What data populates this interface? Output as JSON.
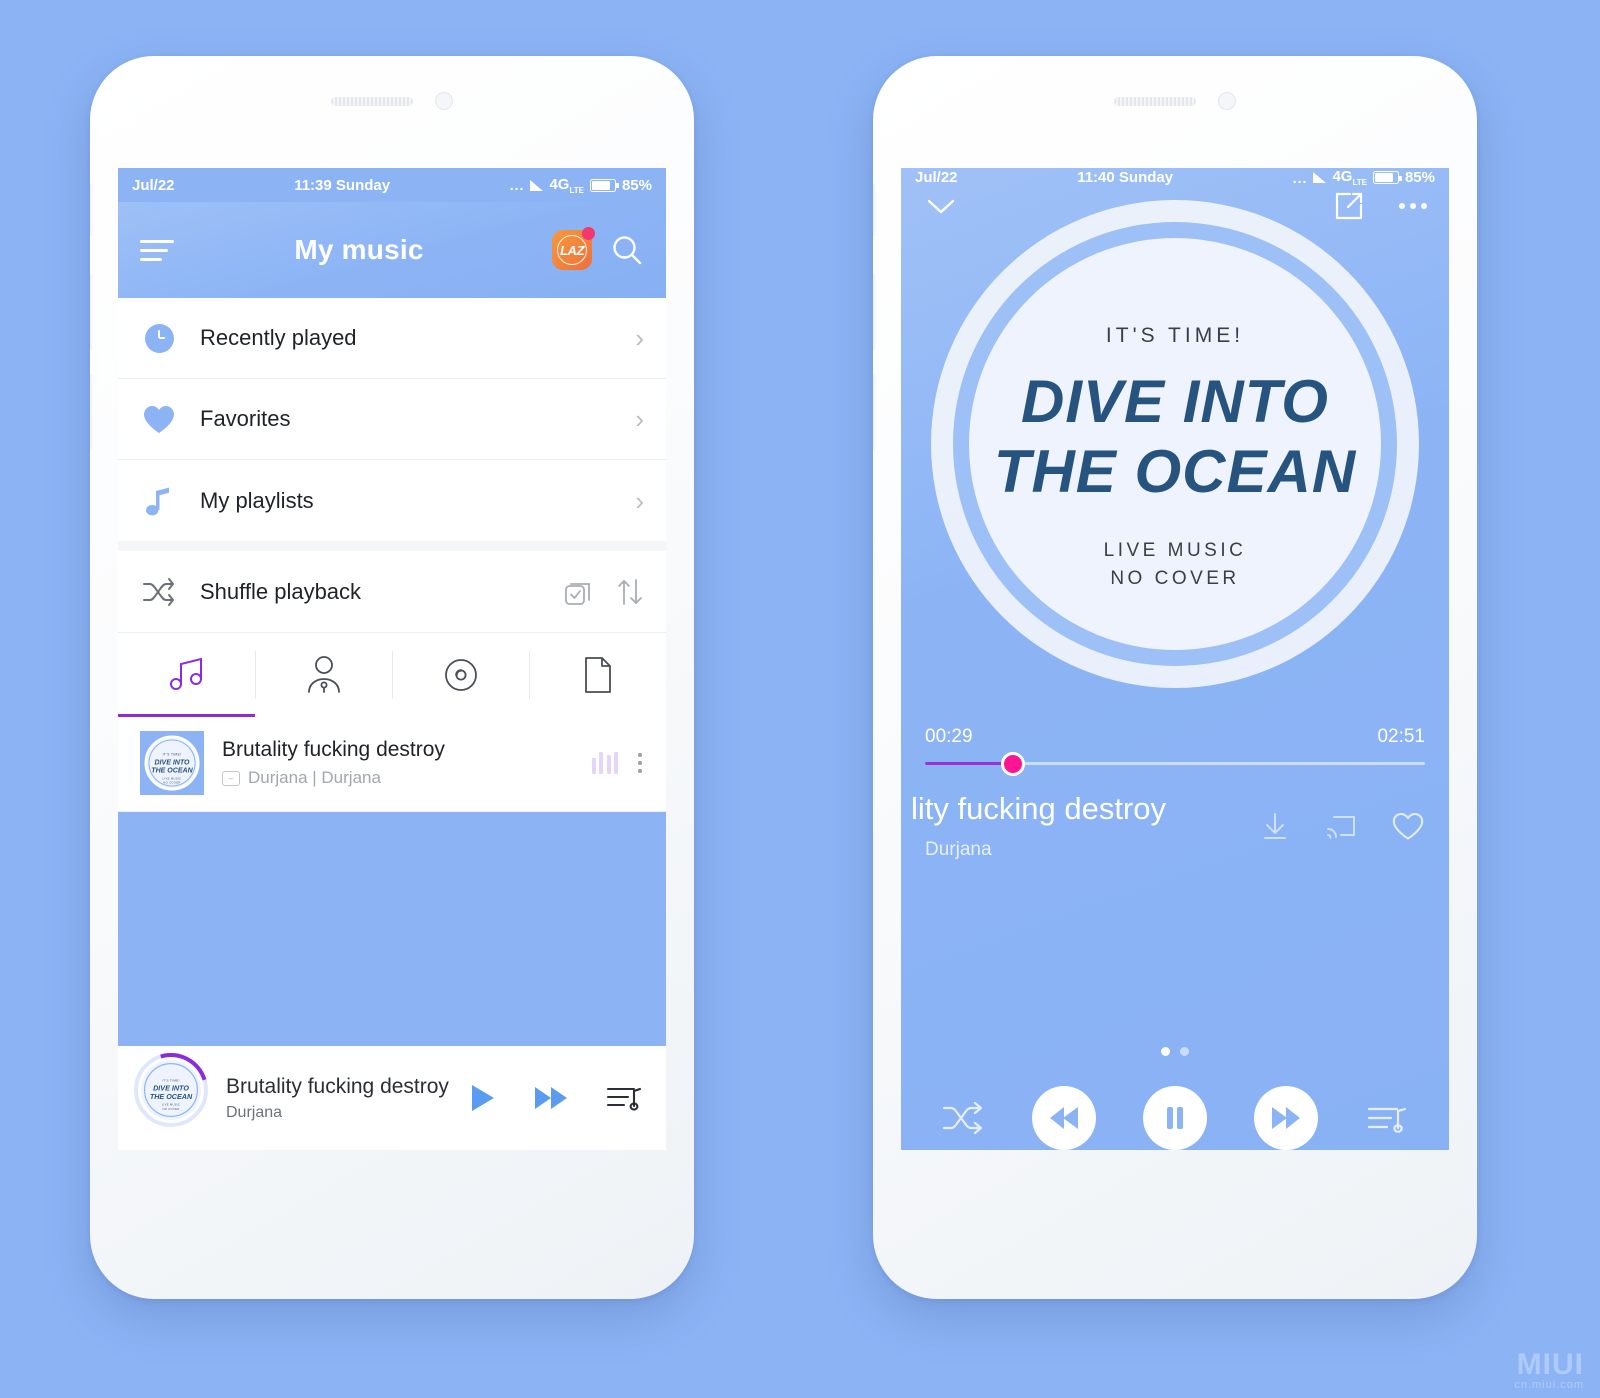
{
  "background_color": "#8CB4F5",
  "accent_purple": "#8a2be2",
  "accent_pink": "#ff1493",
  "watermark": {
    "big": "MIUI",
    "small": "cn.miui.com"
  },
  "phone_left": {
    "status_bar": {
      "date": "Jul/22",
      "time": "11:39 Sunday",
      "dots": "...",
      "network": "4G",
      "network_sub": "LTE",
      "battery": "85%"
    },
    "header": {
      "title": "My music",
      "menu_icon": "hamburger-menu-icon",
      "app_icon_label": "LAZ",
      "app_icon_name": "lazada-icon",
      "search_icon": "search-icon"
    },
    "nav_items": [
      {
        "label": "Recently played",
        "icon": "clock-icon"
      },
      {
        "label": "Favorites",
        "icon": "heart-icon"
      },
      {
        "label": "My playlists",
        "icon": "music-note-icon"
      }
    ],
    "shuffle_row": {
      "label": "Shuffle playback",
      "shuffle_icon": "shuffle-icon",
      "multiselect_icon": "multi-select-checkbox-icon",
      "sort_icon": "sort-icon"
    },
    "tabs": [
      {
        "name": "songs",
        "icon": "double-music-note-icon",
        "active": true
      },
      {
        "name": "artists",
        "icon": "artist-person-icon",
        "active": false
      },
      {
        "name": "albums",
        "icon": "disc-icon",
        "active": false
      },
      {
        "name": "folders",
        "icon": "folder-file-icon",
        "active": false
      }
    ],
    "song_list": [
      {
        "title": "Brutality fucking destroy",
        "format_badge": "–",
        "subtitle": "Durjana | Durjana",
        "playing_indicator": "equalizer-bars-icon",
        "menu_icon": "kebab-menu-icon"
      }
    ],
    "mini_player": {
      "title": "Brutality fucking destroy",
      "artist": "Durjana",
      "play_icon": "play-icon",
      "next_icon": "next-track-icon",
      "queue_icon": "playlist-queue-icon"
    }
  },
  "phone_right": {
    "status_bar": {
      "date": "Jul/22",
      "time": "11:40 Sunday",
      "dots": "...",
      "network": "4G",
      "network_sub": "LTE",
      "battery": "85%"
    },
    "top_bar": {
      "collapse_icon": "chevron-down-icon",
      "share_icon": "share-external-icon",
      "more_icon": "more-horizontal-icon"
    },
    "album_art": {
      "tagline": "IT'S TIME!",
      "line1": "DIVE INTO",
      "line2": "THE OCEAN",
      "sub1": "LIVE MUSIC",
      "sub2": "NO COVER"
    },
    "progress": {
      "elapsed": "00:29",
      "total": "02:51",
      "percent": 17.5
    },
    "now_playing": {
      "title": "lity fucking destroy",
      "artist": "Durjana",
      "download_icon": "download-icon",
      "cast_icon": "cast-icon",
      "favorite_icon": "heart-outline-icon"
    },
    "pager": {
      "total": 2,
      "active_index": 0
    },
    "controls": {
      "shuffle_icon": "shuffle-icon",
      "previous_icon": "previous-track-icon",
      "pause_icon": "pause-icon",
      "next_icon": "next-track-icon",
      "queue_icon": "playlist-queue-icon"
    }
  }
}
